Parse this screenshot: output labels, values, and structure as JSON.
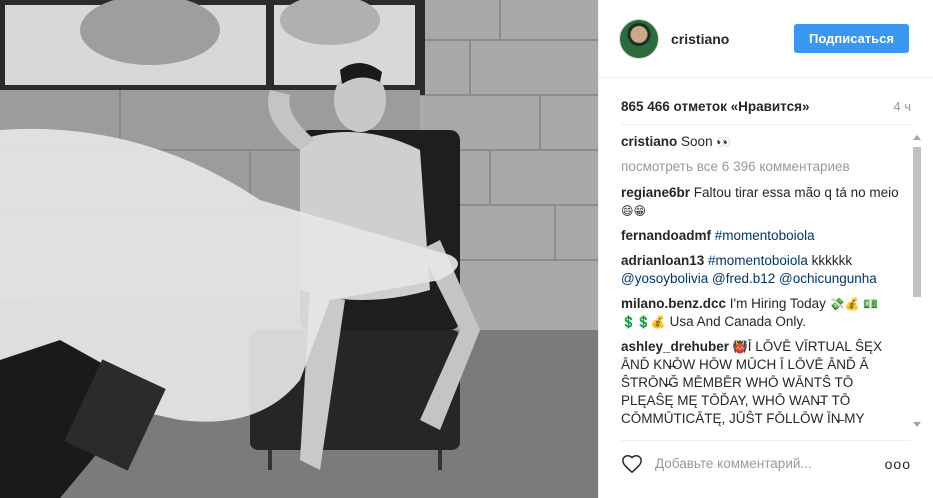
{
  "post": {
    "photo_alt": "post-photo",
    "author": {
      "username": "cristiano",
      "follow_label": "Подписаться"
    },
    "likes_text": "865 466 отметок «Нравится»",
    "time_ago": "4 ч",
    "caption": {
      "username": "cristiano",
      "text": "Soon",
      "emoji": "👀"
    },
    "view_all_comments": "посмотреть все 6 396 комментариев",
    "comments": [
      {
        "username": "regiane6br",
        "text": "Faltou tirar essa mão q tá no meio",
        "emoji": "😄😁"
      },
      {
        "username": "fernandoadmf",
        "tag": "#momentoboiola"
      },
      {
        "username": "adrianloan13",
        "tag": "#momentoboiola",
        "text": "kkkkkk",
        "mentions": "@yosoybolivia @fred.b12 @ochicungunha"
      },
      {
        "username": "milano.benz.dcc",
        "text": "I'm Hiring Today",
        "emoji1": "💸💰",
        "emoji2": "💵💲💲💰",
        "text2": "Usa And Canada Only."
      },
      {
        "username": "ashley_drehuber",
        "emoji": "👹",
        "text": "Ī LŌVĒ VĪRTUAL ŜĘX ĀNĎ KN̶ŌW HŌW MŪCH Ī LŌVĒ ĀNĎ Ā ŜTRŌN̶Ğ MĒMBĒR WHŌ WĀNTŜ TŌ PLĘAŜĘ MĘ TŌĎAY, WHŌ WAN̶T TŌ CŌMMŪTICĀTĘ, JŪŜT FŌLLŌW ĪN̶ MY"
      }
    ],
    "add_comment_placeholder": "Добавьте комментарий...",
    "more_label": "ooo"
  },
  "colors": {
    "accent": "#3897f0",
    "link": "#003569",
    "muted": "#999999",
    "border": "#efefef"
  },
  "icons": {
    "heart": "heart-outline-icon",
    "more": "more-options-icon"
  }
}
